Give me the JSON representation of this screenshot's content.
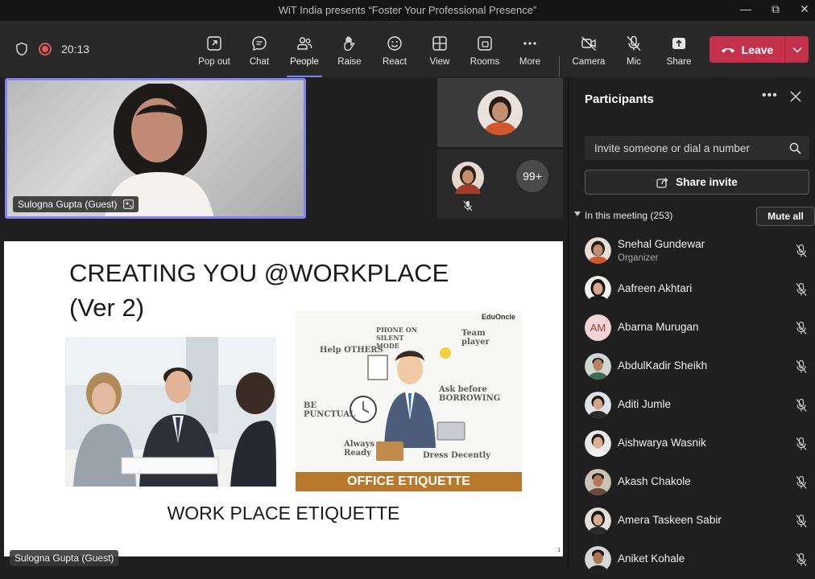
{
  "window": {
    "title": "WiT India presents “Foster Your Professional Presence”",
    "controls": [
      "minimize",
      "restore",
      "close"
    ]
  },
  "toolbar": {
    "timer": "20:13",
    "buttons": [
      {
        "label": "Pop out",
        "icon": "pop-out-icon"
      },
      {
        "label": "Chat",
        "icon": "chat-icon"
      },
      {
        "label": "People",
        "icon": "people-icon",
        "active": true
      },
      {
        "label": "Raise",
        "icon": "hand-icon"
      },
      {
        "label": "React",
        "icon": "smiley-icon"
      },
      {
        "label": "View",
        "icon": "grid-icon"
      },
      {
        "label": "Rooms",
        "icon": "rooms-icon"
      },
      {
        "label": "More",
        "icon": "more-icon"
      },
      {
        "label": "Camera",
        "icon": "camera-off-icon"
      },
      {
        "label": "Mic",
        "icon": "mic-off-icon"
      },
      {
        "label": "Share",
        "icon": "share-icon"
      }
    ],
    "leave_label": "Leave",
    "accent": "#7f85f5",
    "leave_color": "#c4314b"
  },
  "stage": {
    "main_video_name": "Sulogna Gupta (Guest)",
    "overflow_count": "99+",
    "presenter_name": "Sulogna Gupta (Guest)"
  },
  "slide": {
    "title_line1": "CREATING YOU @WORKPLACE",
    "title_line2": "(Ver 2)",
    "etiquette_banner": "OFFICE ETIQUETTE",
    "etiquette_logo": "EduOncle",
    "etiquette_words": [
      "Help OTHERS",
      "PHONE ON SILENT MODE",
      "Team player",
      "Ask before BORROWING",
      "BE PUNCTUAL",
      "Always Ready",
      "Dress Decently"
    ],
    "caption": "WORK PLACE ETIQUETTE",
    "page_number": "1"
  },
  "participants": {
    "title": "Participants",
    "invite_placeholder": "Invite someone or dial a number",
    "share_invite_label": "Share invite",
    "section_label": "In this meeting (253)",
    "mute_all_label": "Mute all",
    "people": [
      {
        "name": "Snehal Gundewar",
        "role": "Organizer",
        "avatar": "photo"
      },
      {
        "name": "Aafreen Akhtari",
        "avatar": "photo"
      },
      {
        "name": "Abarna Murugan",
        "avatar": "initials",
        "initials": "AM"
      },
      {
        "name": "AbdulKadir Sheikh",
        "avatar": "photo"
      },
      {
        "name": "Aditi Jumle",
        "avatar": "photo"
      },
      {
        "name": "Aishwarya Wasnik",
        "avatar": "photo"
      },
      {
        "name": "Akash Chakole",
        "avatar": "photo"
      },
      {
        "name": "Amera Taskeen Sabir",
        "avatar": "photo"
      },
      {
        "name": "Aniket Kohale",
        "avatar": "photo"
      }
    ]
  }
}
